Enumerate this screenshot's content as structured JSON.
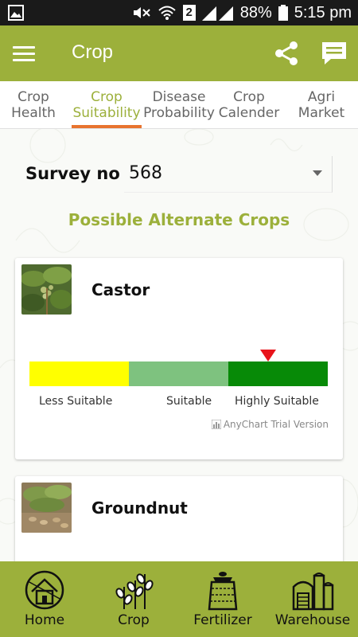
{
  "status_bar": {
    "battery": "88%",
    "time": "5:15 pm",
    "sim_badge": "2",
    "icons": [
      "gallery-icon",
      "mute-icon",
      "wifi-icon",
      "sim-icon",
      "signal-icon",
      "battery-icon"
    ]
  },
  "app_bar": {
    "title": "Crop",
    "icons": [
      "menu-icon",
      "share-icon",
      "chat-icon"
    ]
  },
  "tabs": [
    {
      "label": "Crop\nHealth",
      "active": false
    },
    {
      "label": "Crop\nSuitability",
      "active": true
    },
    {
      "label": "Disease\nProbability",
      "active": false
    },
    {
      "label": "Crop\nCalender",
      "active": false
    },
    {
      "label": "Agri\nMarket",
      "active": false
    }
  ],
  "survey": {
    "label": "Survey no",
    "value": "568"
  },
  "section_title": "Possible Alternate Crops",
  "crops": [
    {
      "name": "Castor",
      "image": "castor-plant-photo",
      "suitability": {
        "levels": [
          "Less Suitable",
          "Suitable",
          "Highly Suitable"
        ],
        "colors": [
          "#ffff00",
          "#7ec27f",
          "#078a07"
        ],
        "marker_position": 0.8
      },
      "watermark": "AnyChart Trial Version"
    },
    {
      "name": "Groundnut",
      "image": "groundnut-plant-photo"
    }
  ],
  "bottom_nav": [
    {
      "label": "Home",
      "icon": "home-icon"
    },
    {
      "label": "Crop",
      "icon": "crop-plant-icon"
    },
    {
      "label": "Fertilizer",
      "icon": "fertilizer-bag-icon"
    },
    {
      "label": "Warehouse",
      "icon": "warehouse-icon"
    }
  ],
  "colors": {
    "primary": "#9cb03b",
    "tab_indicator": "#e8742f",
    "marker": "#e8141b"
  }
}
